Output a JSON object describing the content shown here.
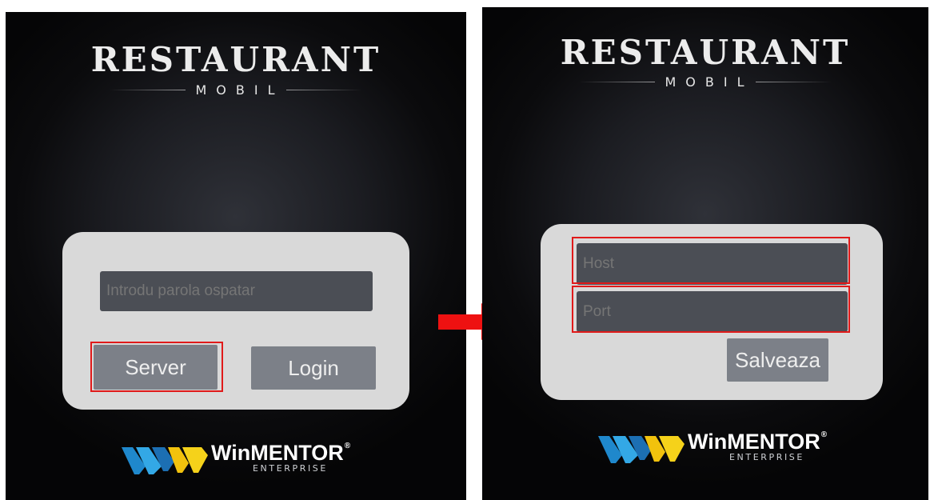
{
  "left_screen": {
    "brand_title": "RESTAURANT",
    "brand_subtitle": "MOBIL",
    "password_placeholder": "Introdu parola ospatar",
    "server_button": "Server",
    "login_button": "Login",
    "logo_name": "WinMENTOR",
    "logo_sub": "ENTERPRISE",
    "logo_reg": "®"
  },
  "right_screen": {
    "brand_title": "RESTAURANT",
    "brand_subtitle": "MOBIL",
    "host_placeholder": "Host",
    "port_placeholder": "Port",
    "save_button": "Salveaza",
    "logo_name": "WinMENTOR",
    "logo_sub": "ENTERPRISE",
    "logo_reg": "®"
  },
  "colors": {
    "highlight": "#e01a1a",
    "arrow": "#ee1111",
    "panel": "#d9d9d9",
    "field": "#4b4e55",
    "button": "#7c8088"
  },
  "icons": {
    "transition": "right-arrow-icon",
    "brand_mark": "winmentor-logo-icon"
  }
}
